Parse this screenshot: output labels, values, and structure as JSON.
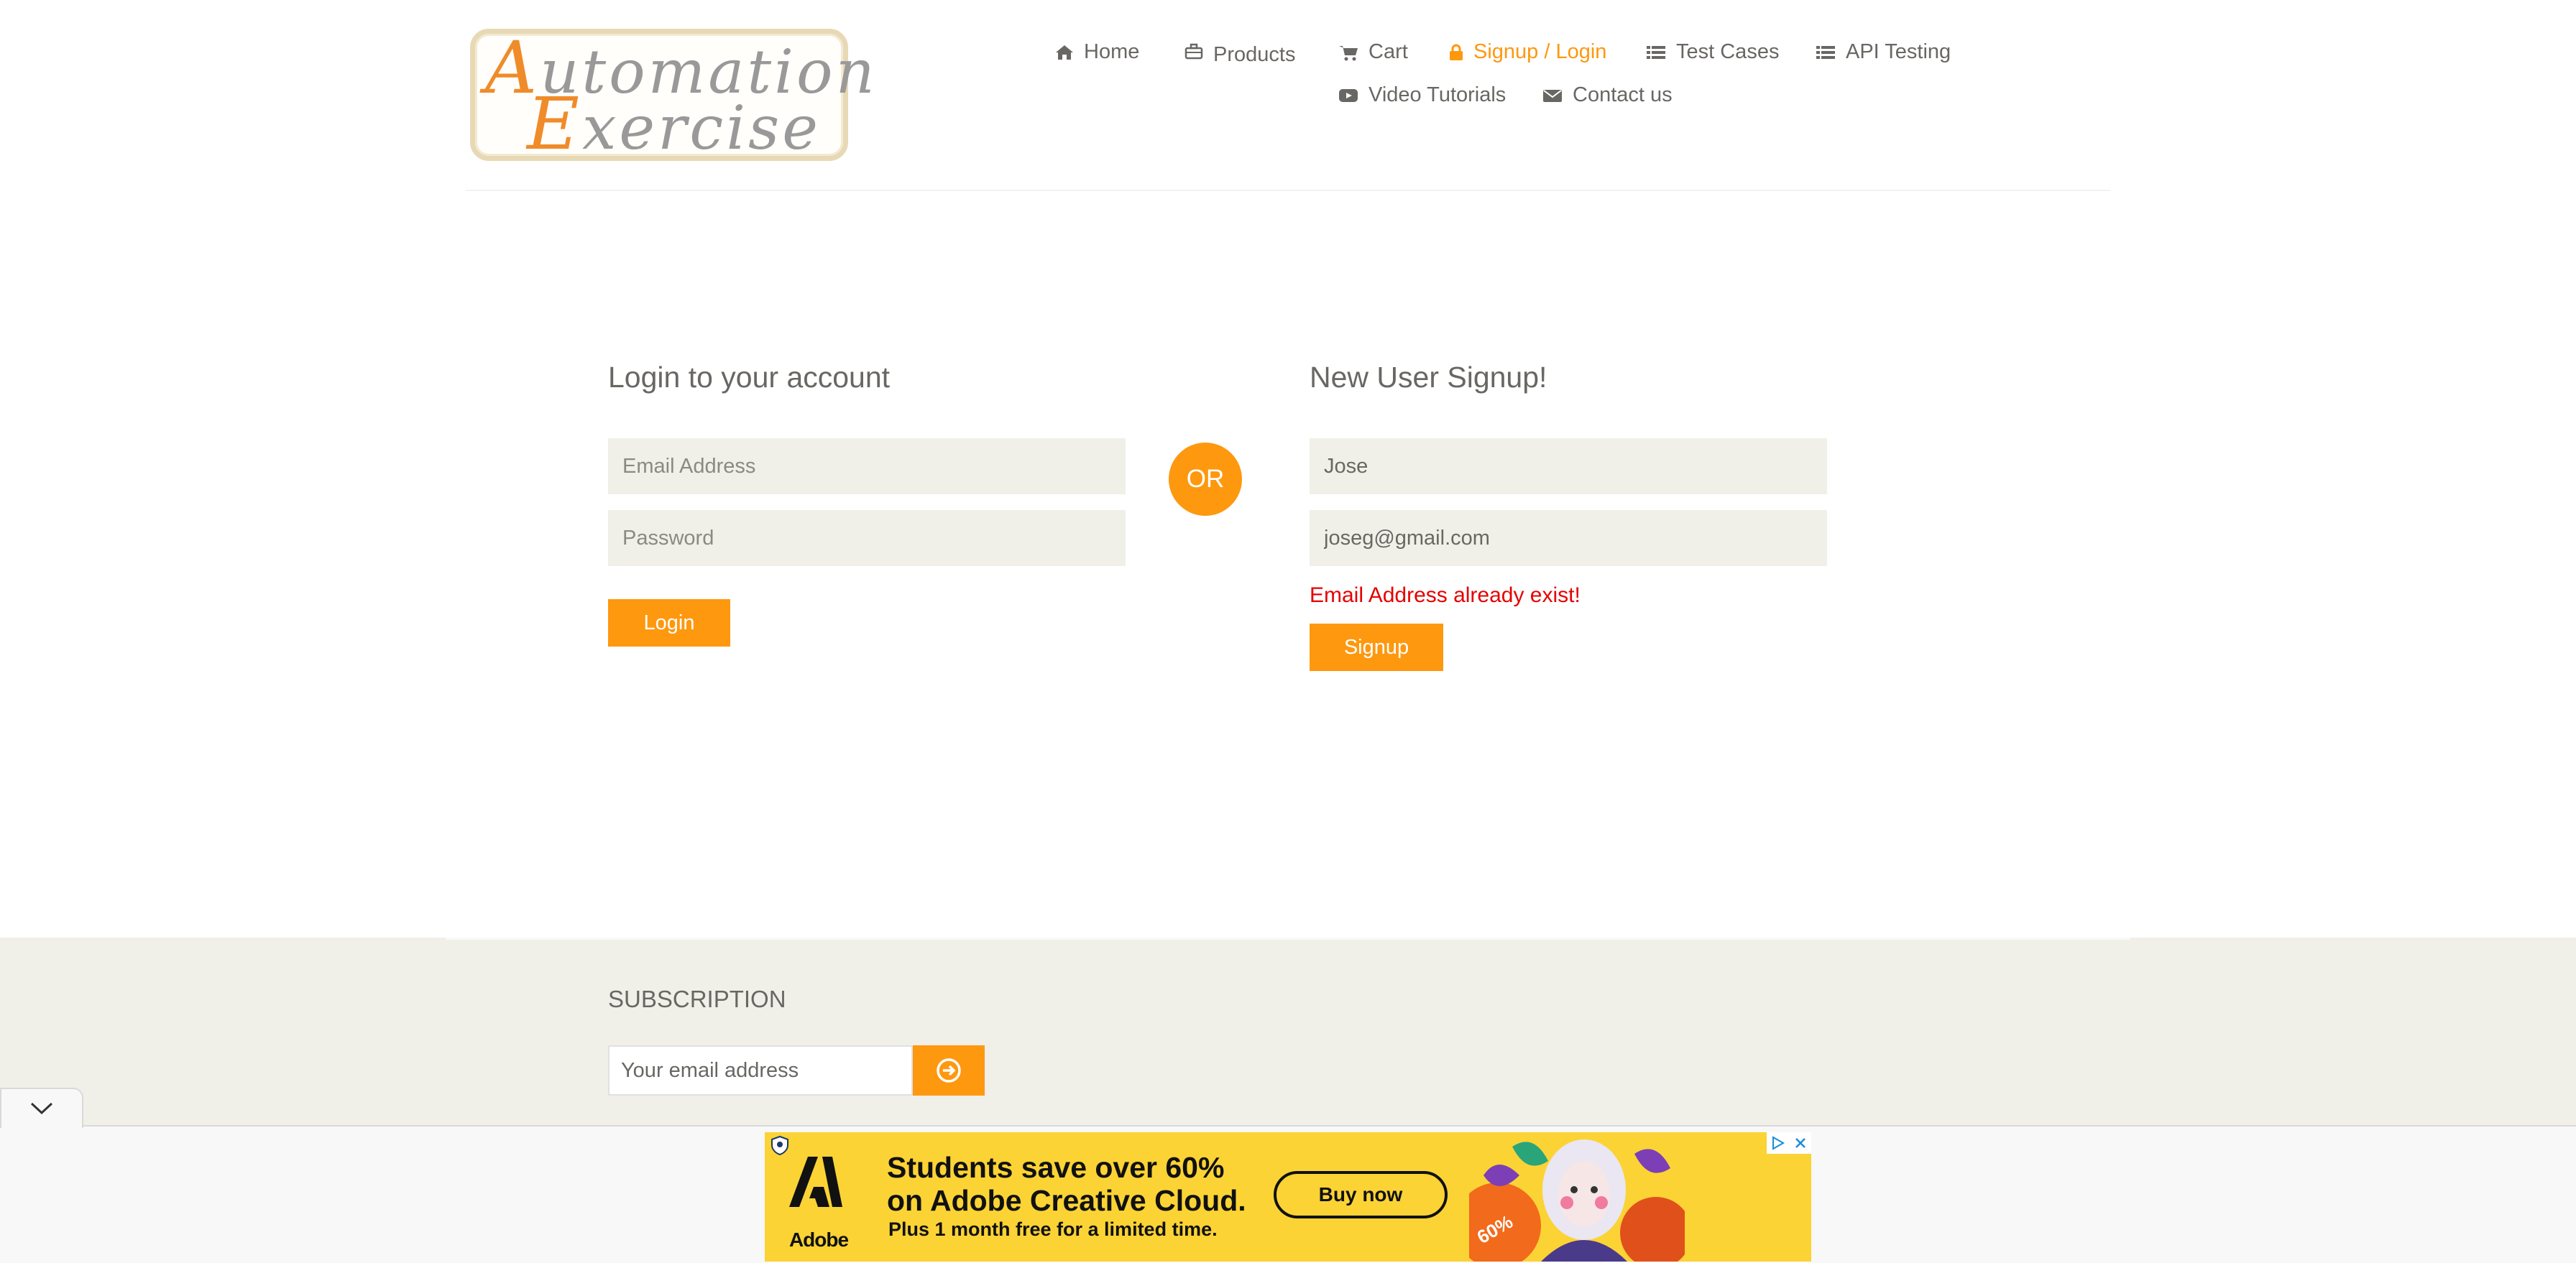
{
  "brand": {
    "logo_line1_cap": "A",
    "logo_line1_rest": "utomation",
    "logo_line2_cap": "E",
    "logo_line2_rest": "xercise"
  },
  "nav": {
    "items": [
      {
        "label": "Home",
        "icon": "home-icon"
      },
      {
        "label": "Products",
        "icon": "briefcase-icon"
      },
      {
        "label": "Cart",
        "icon": "cart-icon"
      },
      {
        "label": "Signup / Login",
        "icon": "lock-icon",
        "active": true
      },
      {
        "label": "Test Cases",
        "icon": "list-icon"
      },
      {
        "label": "API Testing",
        "icon": "list-icon"
      },
      {
        "label": "Video Tutorials",
        "icon": "youtube-play-icon"
      },
      {
        "label": "Contact us",
        "icon": "envelope-icon"
      }
    ]
  },
  "login": {
    "title": "Login to your account",
    "email_placeholder": "Email Address",
    "password_placeholder": "Password",
    "button": "Login"
  },
  "divider": {
    "label": "OR"
  },
  "signup": {
    "title": "New User Signup!",
    "name_value": "Jose",
    "email_value": "joseg@gmail.com",
    "error": "Email Address already exist!",
    "button": "Signup"
  },
  "footer": {
    "subscription_title": "SUBSCRIPTION",
    "email_placeholder": "Your email address",
    "submit_icon": "arrow-circle-right-icon"
  },
  "ad": {
    "brand": "Adobe",
    "headline_line1": "Students save over 60%",
    "headline_line2": "on Adobe Creative Cloud.",
    "subline": "Plus 1 month free for a limited time.",
    "cta": "Buy now",
    "badge": "60%"
  },
  "colors": {
    "accent": "#fe980f",
    "error": "#e60000",
    "text": "#696763",
    "field_bg": "#f0f0e9",
    "ad_bg": "#fbd335"
  }
}
